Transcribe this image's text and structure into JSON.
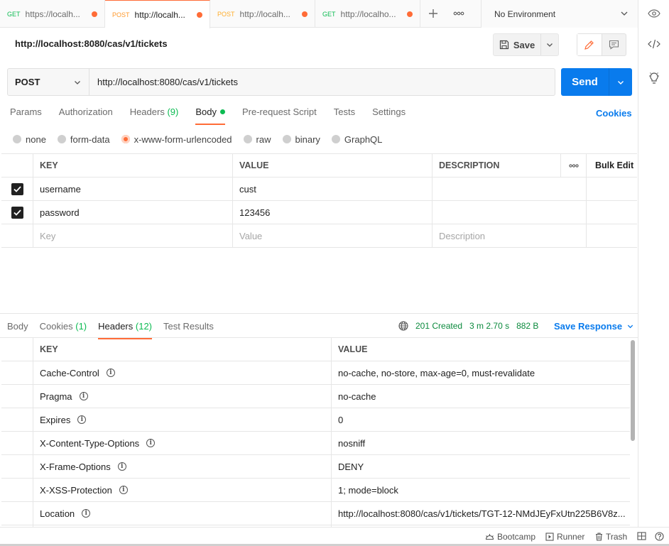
{
  "tabs": [
    {
      "method": "GET",
      "url": "https://localh...",
      "unsaved": true,
      "active": false
    },
    {
      "method": "POST",
      "url": "http://localh...",
      "unsaved": true,
      "active": true
    },
    {
      "method": "POST",
      "url": "http://localh...",
      "unsaved": true,
      "active": false
    },
    {
      "method": "GET",
      "url": "http://localho...",
      "unsaved": true,
      "active": false
    }
  ],
  "environment": "No Environment",
  "request": {
    "title": "http://localhost:8080/cas/v1/tickets",
    "save_label": "Save",
    "method": "POST",
    "url": "http://localhost:8080/cas/v1/tickets",
    "send_label": "Send"
  },
  "request_tabs": {
    "params": "Params",
    "authorization": "Authorization",
    "headers": "Headers",
    "headers_count": "(9)",
    "body": "Body",
    "prerequest": "Pre-request Script",
    "tests": "Tests",
    "settings": "Settings",
    "cookies": "Cookies"
  },
  "body_types": {
    "none": "none",
    "form_data": "form-data",
    "urlencoded": "x-www-form-urlencoded",
    "raw": "raw",
    "binary": "binary",
    "graphql": "GraphQL",
    "selected": "x-www-form-urlencoded"
  },
  "params_table": {
    "headers": {
      "key": "KEY",
      "value": "VALUE",
      "description": "DESCRIPTION",
      "bulk_edit": "Bulk Edit"
    },
    "rows": [
      {
        "key": "username",
        "value": "cust",
        "description": "",
        "checked": true
      },
      {
        "key": "password",
        "value": "123456",
        "description": "",
        "checked": true
      }
    ],
    "placeholders": {
      "key": "Key",
      "value": "Value",
      "description": "Description"
    }
  },
  "response": {
    "tabs": {
      "body": "Body",
      "cookies": "Cookies",
      "cookies_count": "(1)",
      "headers": "Headers",
      "headers_count": "(12)",
      "test_results": "Test Results"
    },
    "status": "201 Created",
    "time": "3 m 2.70 s",
    "size": "882 B",
    "save_response": "Save Response",
    "headers_table": {
      "key_header": "KEY",
      "value_header": "VALUE",
      "rows": [
        {
          "key": "Cache-Control",
          "value": "no-cache, no-store, max-age=0, must-revalidate"
        },
        {
          "key": "Pragma",
          "value": "no-cache"
        },
        {
          "key": "Expires",
          "value": "0"
        },
        {
          "key": "X-Content-Type-Options",
          "value": "nosniff"
        },
        {
          "key": "X-Frame-Options",
          "value": "DENY"
        },
        {
          "key": "X-XSS-Protection",
          "value": "1; mode=block"
        },
        {
          "key": "Location",
          "value": "http://localhost:8080/cas/v1/tickets/TGT-12-NMdJEyFxUtn225B6V8z..."
        }
      ]
    }
  },
  "statusbar": {
    "bootcamp": "Bootcamp",
    "runner": "Runner",
    "trash": "Trash"
  },
  "colors": {
    "accent": "#ff6c37",
    "send": "#097bed",
    "get": "#0cbb52",
    "post": "#ffad2b",
    "status_green": "#0b8a3d"
  }
}
